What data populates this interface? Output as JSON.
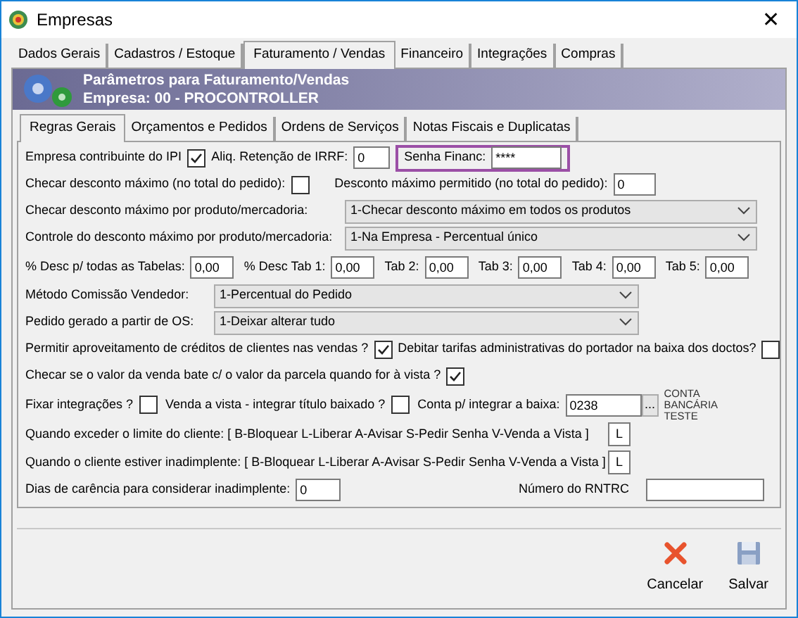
{
  "window": {
    "title": "Empresas",
    "close": "✕"
  },
  "main_tabs": [
    {
      "label": "Dados Gerais",
      "selected": false
    },
    {
      "label": "Cadastros / Estoque",
      "selected": false
    },
    {
      "label": "Faturamento / Vendas",
      "selected": true
    },
    {
      "label": "Financeiro",
      "selected": false
    },
    {
      "label": "Integrações",
      "selected": false
    },
    {
      "label": "Compras",
      "selected": false
    }
  ],
  "header": {
    "title": "Parâmetros para Faturamento/Vendas",
    "subtitle": "Empresa: 00 - PROCONTROLLER"
  },
  "sub_tabs": [
    {
      "label": "Regras Gerais",
      "selected": true
    },
    {
      "label": "Orçamentos e Pedidos",
      "selected": false
    },
    {
      "label": "Ordens de Serviços",
      "selected": false
    },
    {
      "label": "Notas Fiscais e Duplicatas",
      "selected": false
    }
  ],
  "form": {
    "ipi": {
      "label": "Empresa contribuinte do IPI",
      "checked": true
    },
    "irrf": {
      "label": "Aliq. Retenção de IRRF:",
      "value": "0"
    },
    "senha": {
      "label": "Senha Financ:",
      "value": "****"
    },
    "checar_desconto": {
      "label": "Checar desconto máximo (no total do pedido):",
      "checked": false
    },
    "desconto_maximo": {
      "label": "Desconto máximo permitido (no total do pedido):",
      "value": "0"
    },
    "checar_produto": {
      "label": "Checar desconto máximo por produto/mercadoria:",
      "value": "1-Checar desconto máximo em todos os produtos"
    },
    "controle_produto": {
      "label": "Controle do desconto máximo por produto/mercadoria:",
      "value": "1-Na Empresa - Percentual único"
    },
    "descontos": [
      {
        "label": "% Desc p/ todas as Tabelas:",
        "value": "0,00"
      },
      {
        "label": "% Desc Tab 1:",
        "value": "0,00"
      },
      {
        "label": "Tab 2:",
        "value": "0,00"
      },
      {
        "label": "Tab 3:",
        "value": "0,00"
      },
      {
        "label": "Tab 4:",
        "value": "0,00"
      },
      {
        "label": "Tab 5:",
        "value": "0,00"
      }
    ],
    "metodo_comissao": {
      "label": "Método Comissão Vendedor:",
      "value": "1-Percentual do Pedido"
    },
    "pedido_os": {
      "label": "Pedido gerado a partir de OS:",
      "value": "1-Deixar alterar tudo"
    },
    "aproveitamento": {
      "label": "Permitir aproveitamento de créditos de clientes nas vendas ?",
      "checked": true
    },
    "debitar_tarifas": {
      "label": "Debitar tarifas administrativas do portador na baixa dos doctos?",
      "checked": false
    },
    "checar_parcela": {
      "label": "Checar se o valor da venda bate c/ o valor da parcela quando for à vista ?",
      "checked": true
    },
    "fixar_integracoes": {
      "label": "Fixar integrações ?",
      "checked": false
    },
    "venda_vista": {
      "label": "Venda a vista - integrar título baixado ?",
      "checked": false
    },
    "conta_baixa": {
      "label": "Conta p/ integrar a baixa:",
      "value": "0238",
      "button": "...",
      "note": "CONTA BANCÁRIA TESTE"
    },
    "limite_cliente": {
      "label": "Quando exceder o limite do cliente: [ B-Bloquear L-Liberar A-Avisar S-Pedir Senha V-Venda a Vista ]",
      "value": "L"
    },
    "inadimplente": {
      "label": "Quando o cliente estiver inadimplente: [ B-Bloquear L-Liberar A-Avisar S-Pedir Senha V-Venda a Vista ]",
      "value": "L"
    },
    "dias_carencia": {
      "label": "Dias de carência para considerar inadimplente:",
      "value": "0"
    },
    "rntrc": {
      "label": "Número do RNTRC"
    }
  },
  "buttons": [
    {
      "label": "Cancelar",
      "kind": "cancel"
    },
    {
      "label": "Salvar",
      "kind": "save"
    }
  ]
}
